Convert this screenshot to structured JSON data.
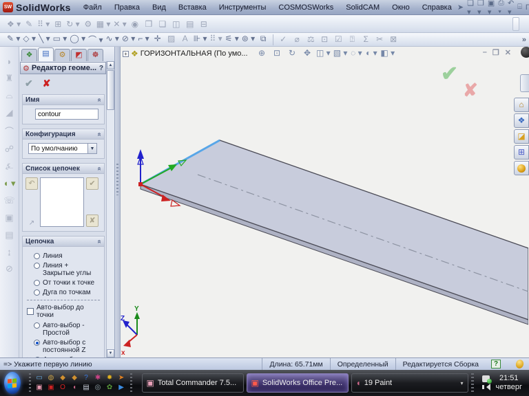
{
  "colors": {
    "plate_fill": "#c8ccdc",
    "edge_highlight": "#58a6e8",
    "triad_x": "#cc2222",
    "triad_y": "#1a8a1a",
    "triad_z": "#2222cc",
    "taskbar_active": "#5a4a8a"
  },
  "window": {
    "logo_short": "SW",
    "title": "SolidWorks",
    "menu": [
      {
        "name": "menu-file",
        "label": "Файл"
      },
      {
        "name": "menu-edit",
        "label": "Правка"
      },
      {
        "name": "menu-view",
        "label": "Вид"
      },
      {
        "name": "menu-insert",
        "label": "Вставка"
      },
      {
        "name": "menu-tools",
        "label": "Инструменты"
      },
      {
        "name": "menu-cosmosworks",
        "label": "COSMOSWorks"
      },
      {
        "name": "menu-solidcam",
        "label": "SolidCAM"
      },
      {
        "name": "menu-window",
        "label": "Окно"
      },
      {
        "name": "menu-help",
        "label": "Справка"
      }
    ],
    "quick_tools": [
      {
        "name": "select-cursor-icon",
        "glyph": "➤",
        "cls": "ttool"
      },
      {
        "name": "new-document-icon",
        "glyph": "❏ ▾",
        "cls": "ttool"
      },
      {
        "name": "open-document-icon",
        "glyph": "❐ ▾",
        "cls": "ttool"
      },
      {
        "name": "save-icon",
        "glyph": "▣ ▾",
        "cls": "ttool"
      },
      {
        "name": "print-icon",
        "glyph": "⎙ ▾",
        "cls": "ttool"
      },
      {
        "name": "undo-icon",
        "glyph": "↶ ▾",
        "cls": "ttool"
      },
      {
        "name": "rebuild-icon",
        "glyph": "⌸",
        "cls": "ttool"
      },
      {
        "name": "options-label",
        "glyph": "Г...",
        "cls": "ttool"
      },
      {
        "name": "help-icon",
        "glyph": "? ▾",
        "cls": "ttool"
      }
    ],
    "controls": {
      "minimize": "–",
      "restore": "❐",
      "close": "✕"
    }
  },
  "toolbars": {
    "assembly_row": [
      {
        "name": "insert-component-icon",
        "glyph": "❖ ▾"
      },
      {
        "name": "mate-icon",
        "glyph": "✎"
      },
      {
        "name": "linear-pattern-icon",
        "glyph": "⠿ ▾"
      },
      {
        "name": "smart-fasteners-icon",
        "glyph": "⊞"
      },
      {
        "name": "move-component-icon",
        "glyph": "↻ ▾"
      },
      {
        "name": "show-hidden-icon",
        "glyph": "⚙"
      },
      {
        "name": "assembly-features-icon",
        "glyph": "▦ ▾"
      },
      {
        "name": "reference-geometry-icon",
        "glyph": "✕ ▾"
      },
      {
        "name": "motion-study-icon",
        "glyph": "◉"
      },
      {
        "name": "exploded-view-icon",
        "glyph": "❒"
      },
      {
        "name": "explode-sketch-icon",
        "glyph": "❏"
      },
      {
        "name": "interference-icon",
        "glyph": "◫"
      },
      {
        "name": "assembly-xpert-icon",
        "glyph": "▤"
      },
      {
        "name": "bom-icon",
        "glyph": "⊟"
      }
    ],
    "sketch_row": [
      {
        "name": "sketch-icon",
        "glyph": "✎ ▾",
        "cls": "en"
      },
      {
        "name": "smart-dimension-icon",
        "glyph": "◇ ▾",
        "cls": "en"
      },
      {
        "name": "line-icon",
        "glyph": "╲ ▾",
        "cls": "en"
      },
      {
        "name": "rectangle-icon",
        "glyph": "▭ ▾",
        "cls": "en"
      },
      {
        "name": "circle-icon",
        "glyph": "◯ ▾",
        "cls": "en"
      },
      {
        "name": "arc-icon",
        "glyph": "⌒ ▾",
        "cls": "en"
      },
      {
        "name": "spline-icon",
        "glyph": "∿ ▾",
        "cls": "en"
      },
      {
        "name": "ellipse-icon",
        "glyph": "⊘ ▾",
        "cls": "en"
      },
      {
        "name": "fillet-icon",
        "glyph": "⌐ ▾",
        "cls": "en"
      },
      {
        "name": "point-icon",
        "glyph": "✛",
        "cls": "en"
      },
      {
        "name": "hatch-icon",
        "glyph": "▨"
      },
      {
        "name": "text-icon",
        "glyph": "A"
      },
      {
        "name": "mirror-icon",
        "glyph": "⊪ ▾",
        "cls": "en"
      },
      {
        "name": "pattern-icon",
        "glyph": "⠿ ▾"
      },
      {
        "name": "trim-icon",
        "glyph": "⚟ ▾",
        "cls": "en"
      },
      {
        "name": "offset-icon",
        "glyph": "⊚ ▾",
        "cls": "en"
      },
      {
        "name": "convert-icon",
        "glyph": "⧉",
        "cls": "en"
      }
    ],
    "tools_row": [
      {
        "name": "spellcheck-icon",
        "glyph": "✓"
      },
      {
        "name": "measure-icon",
        "glyph": "⌀"
      },
      {
        "name": "mass-properties-icon",
        "glyph": "⚖"
      },
      {
        "name": "section-properties-icon",
        "glyph": "⊡"
      },
      {
        "name": "check-icon",
        "glyph": "☑"
      },
      {
        "name": "stats-icon",
        "glyph": "⍰"
      },
      {
        "name": "equations-icon",
        "glyph": "Σ"
      },
      {
        "name": "deviation-icon",
        "glyph": "✂"
      },
      {
        "name": "compare-icon",
        "glyph": "⊠"
      }
    ],
    "overflow": "»"
  },
  "left_toolbar": [
    {
      "name": "extruded-boss-icon",
      "glyph": "◗"
    },
    {
      "name": "revolved-boss-icon",
      "glyph": "♜"
    },
    {
      "name": "swept-boss-icon",
      "glyph": "⌓"
    },
    {
      "name": "lofted-boss-icon",
      "glyph": "◢"
    },
    {
      "name": "extruded-cut-icon",
      "glyph": "⌒"
    },
    {
      "name": "fillet-feature-icon",
      "glyph": "☍"
    },
    {
      "name": "rib-icon",
      "glyph": "⍼"
    },
    {
      "name": "shell-icon",
      "glyph": "◖ ▾",
      "cls": "en"
    },
    {
      "name": "draft-icon",
      "glyph": "☏"
    },
    {
      "name": "hole-wizard-icon",
      "glyph": "▣"
    },
    {
      "name": "dome-icon",
      "glyph": "▤"
    },
    {
      "name": "mirror-feature-icon",
      "glyph": "↨"
    },
    {
      "name": "pattern-feature-icon",
      "glyph": "⊘"
    }
  ],
  "panel": {
    "tabs": [
      {
        "name": "tab-featuremanager",
        "glyph": "❖",
        "color": "#3a8a3a"
      },
      {
        "name": "tab-propertymanager",
        "glyph": "▤",
        "color": "#3a6ac0",
        "cls": "sel"
      },
      {
        "name": "tab-configurationmanager",
        "glyph": "⚙",
        "color": "#b8862a"
      },
      {
        "name": "tab-dimxpertmanager",
        "glyph": "◩",
        "color": "#c03030"
      },
      {
        "name": "tab-addin",
        "glyph": "☸",
        "color": "#aa2222"
      }
    ],
    "title": "Редактор геоме...",
    "help": "?",
    "ok": "✔",
    "cancel": "✘",
    "groups": {
      "name": {
        "label": "Имя",
        "value": "contour"
      },
      "config": {
        "label": "Конфигурация",
        "value": "По умолчанию"
      },
      "chain_list": {
        "label": "Список цепочек"
      },
      "chain": {
        "label": "Цепочка",
        "options": [
          "Линия",
          "Линия + Закрытые углы",
          "От точки к точке",
          "Дуга по точкам"
        ],
        "checkbox_label": "Авто-выбор до точки",
        "auto_options": [
          "Авто-выбор - Простой",
          "Авто-выбор с постоянной Z",
          "Авто-выбор в диапазоне по Z"
        ],
        "selected_option": "Авто-выбор с постоянной Z"
      }
    }
  },
  "viewport": {
    "tree_expand": "+",
    "tree_label": "ГОРИЗОНТАЛЬНАЯ (По умо...",
    "view_toolbar": [
      {
        "name": "zoom-fit-icon",
        "glyph": "⊕"
      },
      {
        "name": "zoom-area-icon",
        "glyph": "⊡"
      },
      {
        "name": "rotate-view-icon",
        "glyph": "↻"
      },
      {
        "name": "pan-icon",
        "glyph": "✥"
      },
      {
        "name": "standard-views-icon",
        "glyph": "◫ ▾"
      },
      {
        "name": "display-style-icon",
        "glyph": "▧ ▾"
      },
      {
        "name": "hide-show-items-icon",
        "glyph": "◌ ▾"
      },
      {
        "name": "appearance-icon",
        "glyph": "◐ ▾"
      },
      {
        "name": "section-view-icon",
        "glyph": "◧ ▾"
      }
    ],
    "confirm_ok": "✔",
    "confirm_cancel": "✘",
    "taskpane_tabs": [
      {
        "name": "taskpane-resources-icon",
        "glyph": "⌂",
        "color": "#b8862a"
      },
      {
        "name": "taskpane-design-library-icon",
        "glyph": "❖",
        "color": "#3a6ac0"
      },
      {
        "name": "taskpane-file-explorer-icon",
        "glyph": "◪",
        "color": "#d8a020"
      },
      {
        "name": "taskpane-view-palette-icon",
        "glyph": "⊞",
        "color": "#4a5ac8"
      }
    ],
    "triad_labels": {
      "x": "x",
      "y": "Y",
      "z": "Z"
    }
  },
  "statusbar": {
    "prompt": "=> Укажите первую линию",
    "length": "Длина: 65.71мм",
    "state": "Определенный",
    "mode": "Редактируется Сборка",
    "help_badge": "?"
  },
  "taskbar": {
    "quicklaunch": [
      {
        "name": "ql-show-desktop-icon",
        "glyph": "▭",
        "color": "#6ab0e8"
      },
      {
        "name": "ql-pink-app-icon",
        "glyph": "▣",
        "color": "#e89ab0"
      },
      {
        "name": "ql-globe-icon",
        "glyph": "◍",
        "color": "#c8a24a"
      },
      {
        "name": "ql-solidworks-icon",
        "glyph": "▣",
        "color": "#cc2222"
      },
      {
        "name": "ql-helmet1-icon",
        "glyph": "◆",
        "color": "#d09030"
      },
      {
        "name": "ql-opera-icon",
        "glyph": "O",
        "color": "#dd2222"
      },
      {
        "name": "ql-helmet2-icon",
        "glyph": "◆",
        "color": "#d09030"
      },
      {
        "name": "ql-paint-icon",
        "glyph": "◖",
        "color": "#cc6688"
      },
      {
        "name": "ql-question-icon",
        "glyph": "?",
        "color": "#3a7ae0"
      },
      {
        "name": "ql-document-icon",
        "glyph": "▤",
        "color": "#c8cdd8"
      },
      {
        "name": "ql-colorful-app-icon",
        "glyph": "✱",
        "color": "#cc4488"
      },
      {
        "name": "ql-gray-app-icon",
        "glyph": "◎",
        "color": "#99aab0"
      },
      {
        "name": "ql-star-app-icon",
        "glyph": "✸",
        "color": "#e0b020"
      },
      {
        "name": "ql-green-app-icon",
        "glyph": "✿",
        "color": "#5a9a3a"
      },
      {
        "name": "ql-orange-arrow-icon",
        "glyph": "➤",
        "color": "#e08020"
      },
      {
        "name": "ql-media-play-icon",
        "glyph": "▶",
        "color": "#3a8ae0"
      }
    ],
    "buttons": [
      {
        "label": "Total Commander 7.5...",
        "icon_color": "#e8a0b8",
        "active": false
      },
      {
        "label": "SolidWorks Office Pre...",
        "icon_color": "#cc2222",
        "active": true
      },
      {
        "label": "19 Paint",
        "icon_color": "#cc6688",
        "active": false,
        "group_caret": "▾"
      }
    ],
    "clock": {
      "time": "21:51",
      "day": "четверг"
    }
  }
}
